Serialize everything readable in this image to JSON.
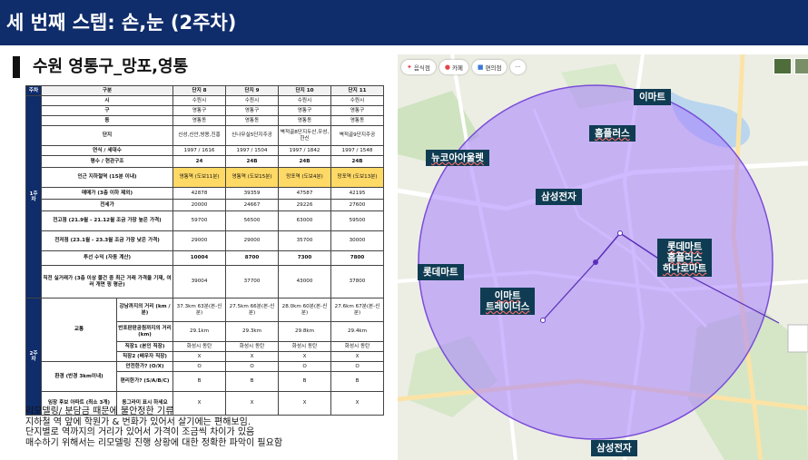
{
  "header": {
    "title": "세 번째 스텝: 손,눈 (2주차)"
  },
  "subtitle": "수원 영통구_망포,영통",
  "table": {
    "col_week": "주차",
    "col_category": "구분",
    "complexes": [
      "단지 8",
      "단지 9",
      "단지 10",
      "단지 11"
    ],
    "week1": "1주차",
    "week2": "2주차",
    "rows": [
      {
        "label": "시",
        "values": [
          "수원시",
          "수원시",
          "수원시",
          "수원시"
        ]
      },
      {
        "label": "구",
        "values": [
          "영통구",
          "영통구",
          "영통구",
          "영통구"
        ]
      },
      {
        "label": "동",
        "values": [
          "영통동",
          "영통동",
          "영통동",
          "영통동"
        ]
      },
      {
        "label": "단지",
        "values": [
          "신성,신안,쌍용,진흥",
          "신나무실5단지주공",
          "벽적골8단지두산,우성,한신",
          "벽적골9단지주공"
        ]
      },
      {
        "label": "연식 / 세대수",
        "values": [
          "1997 / 1616",
          "1997 / 1504",
          "1997 / 1842",
          "1997 / 1548"
        ]
      },
      {
        "label": "평수 / 현관구조",
        "values": [
          "24",
          "24B",
          "24B",
          "24B"
        ]
      },
      {
        "label": "인근 지하철역 (15분 이내)",
        "values": [
          "영통역 (도보11분)",
          "영통역 (도보15분)",
          "망포역 (도보4분)",
          "망포역 (도보13분)"
        ]
      },
      {
        "label": "매매가 (3층 이하 제외)",
        "values": [
          "42878",
          "39359",
          "47587",
          "42195"
        ]
      },
      {
        "label": "전세가",
        "values": [
          "20000",
          "24667",
          "29226",
          "27600"
        ]
      },
      {
        "label": "전고점 (21.9월 - 21.12월 조금 가장 높은 가격)",
        "values": [
          "59700",
          "56500",
          "63000",
          "59500"
        ]
      },
      {
        "label": "전저점 (23.1월 - 23.3월 조금 가장 낮은 가격)",
        "values": [
          "29000",
          "29000",
          "35700",
          "30000"
        ]
      },
      {
        "label": "투선 수익 (자동 계산)",
        "values": [
          "10004",
          "8700",
          "7300",
          "7800"
        ]
      },
      {
        "label": "직전 실거래가 (3층 이상 물건 중 최근 거래 가격을 기재, 여러 개면 핑 평균)",
        "values": [
          "39004",
          "37700",
          "43000",
          "37800"
        ]
      }
    ],
    "transport": {
      "group": "교통",
      "rows": [
        {
          "label": "강남까지의 거리 (km / 분)",
          "values": [
            "37.3km 63분(본-신분)",
            "27.5km 66분(본-신분)",
            "28.0km 60분(본-신분)",
            "27.6km 67분(본-신분)"
          ]
        },
        {
          "label": "반포판판공원까지의 거리 (km)",
          "values": [
            "29.1km",
            "29.3km",
            "29.8km",
            "29.4km"
          ]
        },
        {
          "label": "직장1 (본인 직장)",
          "values": [
            "화성시 동탄",
            "화성시 동탄",
            "화성시 동탄",
            "화성시 동탄"
          ]
        },
        {
          "label": "직장2 (배우자 직장)",
          "values": [
            "X",
            "X",
            "X",
            "X"
          ]
        }
      ]
    },
    "environment": {
      "group": "환경 (반경 3km이내)",
      "rows": [
        {
          "label": "안전한가? (O/X)",
          "values": [
            "O",
            "O",
            "O",
            "O"
          ]
        },
        {
          "label": "편리한가? (S/A/B/C)",
          "values": [
            "B",
            "B",
            "B",
            "B"
          ]
        }
      ]
    },
    "last_row": {
      "group": "임장 후보 아파트 (최소 3개)",
      "label": "동그라미 표시 하세요",
      "values": [
        "X",
        "X",
        "X",
        "X"
      ]
    }
  },
  "notes": [
    "리모델링/ 분담금 때문에 불안정한 기류",
    "지하철 역 앞에 학원가 & 번화가 있어서 살기에는 편해보임.",
    "단지별로 역까지의 거리가 있어서 가격이 조금씩 차이가 있음",
    "매수하기 위해서는 리모델링 진행 상황에 대한 정확한 파악이 필요함"
  ],
  "map": {
    "chips": [
      "음식점",
      "카페",
      "편의점",
      "···"
    ],
    "thumb_labels": [],
    "labels": {
      "emart_top": "이마트",
      "homeplus_top": "홈플러스",
      "newcore": "뉴코아아울렛",
      "samsung_mid": "삼성전자",
      "lotte_combo_1": "롯데마트",
      "lotte_combo_2": "홈플러스",
      "lotte_combo_3": "하나로마트",
      "lottemart_left": "롯데마트",
      "emart_traders_1": "이마트",
      "emart_traders_2": "트레이더스",
      "samsung_bottom": "삼성전자"
    },
    "colors": {
      "circle_fill": "#a880ff",
      "circle_stroke": "#7a4dd8",
      "label_bg": "#0f3c52",
      "banner": "#0f2c6b",
      "highlight": "#ffd966"
    }
  }
}
